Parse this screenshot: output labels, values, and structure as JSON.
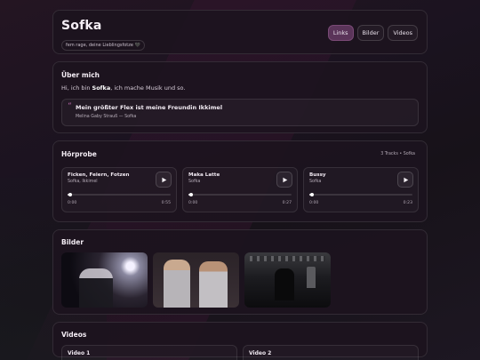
{
  "header": {
    "title": "Sofka",
    "tagline": "fem rage, deine Lieblingsfotze 🖤",
    "nav": [
      "Links",
      "Bilder",
      "Videos"
    ]
  },
  "about": {
    "title": "Über mich",
    "text_prefix": "Hi, ich bin ",
    "name": "Sofka",
    "text_suffix": ", ich mache Musik und so.",
    "quote": "Mein größter Flex ist meine Freundin Ikkimel",
    "quote_author": "Melina Gaby Strauß — Sofka"
  },
  "tracks": {
    "title": "Hörprobe",
    "meta": "3 Tracks • Sofka",
    "items": [
      {
        "name": "Ficken, Feiern, Fotzen",
        "artist": "Sofka, Ikkimel",
        "current": "0:00",
        "duration": "0:55",
        "progress": 0.02
      },
      {
        "name": "Maka Latte",
        "artist": "Sofka",
        "current": "0:00",
        "duration": "0:27",
        "progress": 0.02
      },
      {
        "name": "Bussy",
        "artist": "Sofka",
        "current": "0:00",
        "duration": "0:23",
        "progress": 0.02
      }
    ]
  },
  "gallery": {
    "title": "Bilder",
    "images": [
      "photo-night-mirror",
      "photo-two-girls-hoodies",
      "photo-bw-night-street"
    ]
  },
  "videos": {
    "title": "Videos",
    "items": [
      "Video 1",
      "Video 2"
    ]
  },
  "colors": {
    "accent": "#5a3459",
    "background": "#15101a"
  }
}
